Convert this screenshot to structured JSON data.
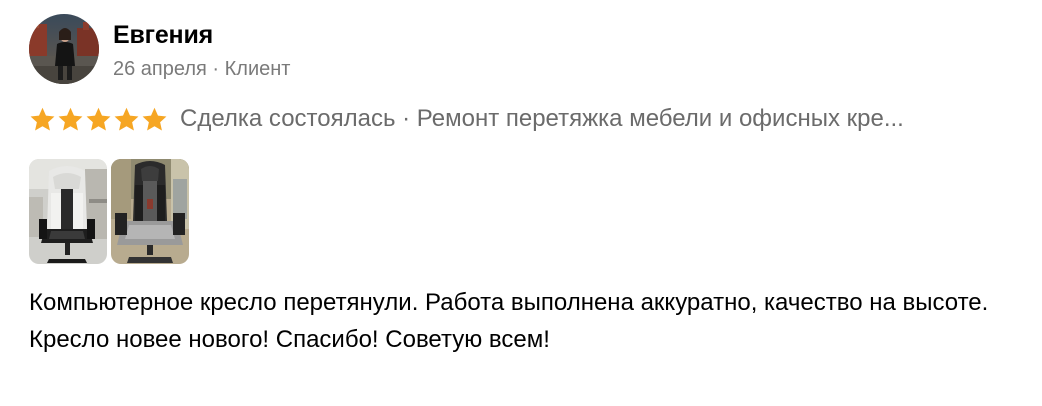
{
  "author": {
    "name": "Евгения",
    "avatar": "avatar-photo"
  },
  "meta": {
    "date": "26 апреля",
    "separator": " · ",
    "role": "Клиент"
  },
  "rating": {
    "stars": 5,
    "max": 5,
    "star_color": "#f6a623",
    "deal_text": "Сделка состоялась · Ремонт перетяжка мебели и офисных кре..."
  },
  "photos": [
    {
      "name": "chair-photo-1"
    },
    {
      "name": "chair-photo-2"
    }
  ],
  "review": {
    "text": "Компьютерное кресло перетянули. Работа выполнена аккуратно, качество на высоте. Кресло новее нового! Спасибо! Советую всем!"
  }
}
